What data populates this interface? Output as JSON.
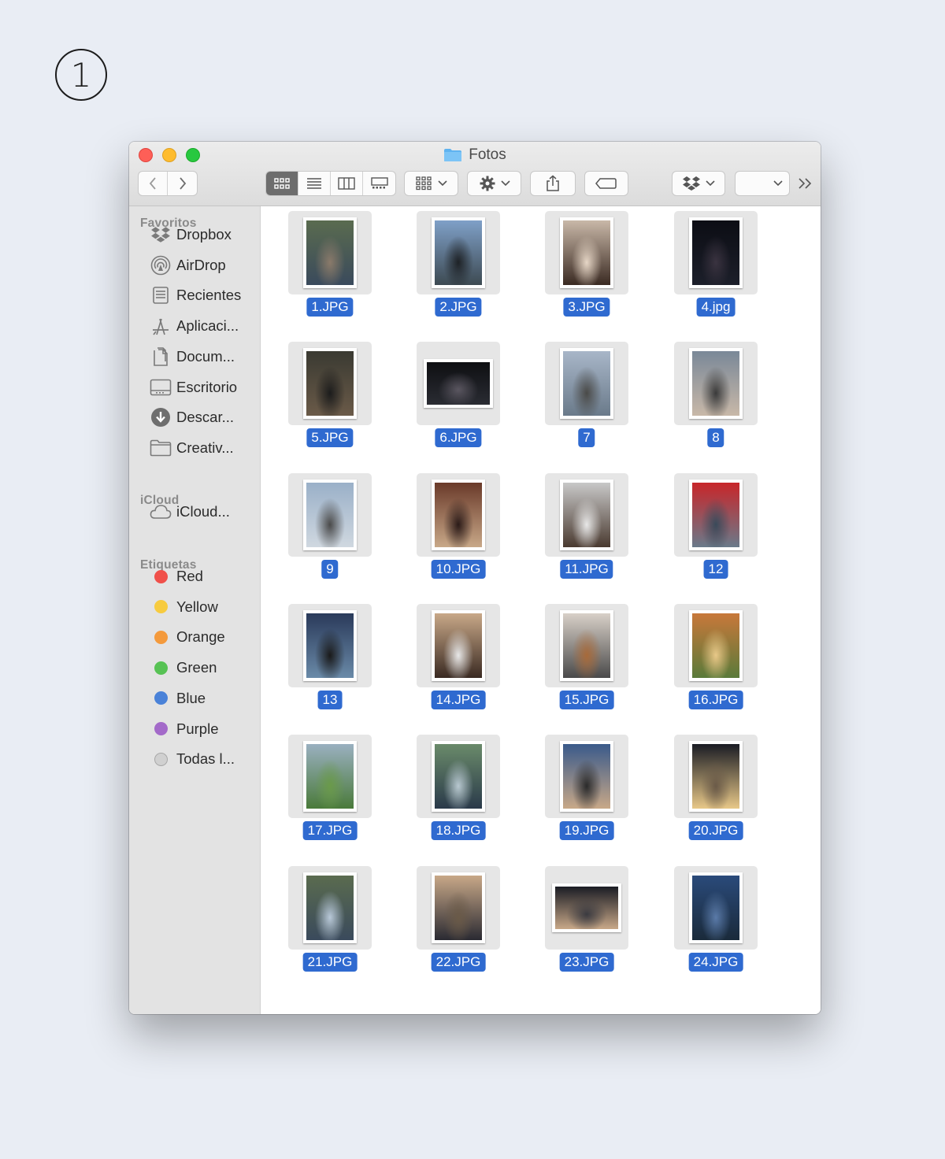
{
  "step": {
    "number": "1"
  },
  "window": {
    "title": "Fotos"
  },
  "sidebar": {
    "favorites_header": "Favoritos",
    "favorites": [
      {
        "label": "Dropbox",
        "icon": "dropbox-icon"
      },
      {
        "label": "AirDrop",
        "icon": "airdrop-icon"
      },
      {
        "label": "Recientes",
        "icon": "recents-icon"
      },
      {
        "label": "Aplicaci...",
        "icon": "applications-icon"
      },
      {
        "label": "Docum...",
        "icon": "documents-icon"
      },
      {
        "label": "Escritorio",
        "icon": "desktop-icon"
      },
      {
        "label": "Descar...",
        "icon": "downloads-icon"
      },
      {
        "label": "Creativ...",
        "icon": "folder-icon"
      }
    ],
    "icloud_header": "iCloud",
    "icloud": [
      {
        "label": "iCloud...",
        "icon": "icloud-icon"
      }
    ],
    "tags_header": "Etiquetas",
    "tags": [
      {
        "label": "Red",
        "color": "#f0504a"
      },
      {
        "label": "Yellow",
        "color": "#f7cb3f"
      },
      {
        "label": "Orange",
        "color": "#f49a3c"
      },
      {
        "label": "Green",
        "color": "#57c254"
      },
      {
        "label": "Blue",
        "color": "#4a82d8"
      },
      {
        "label": "Purple",
        "color": "#a36ac9"
      },
      {
        "label": "Todas l...",
        "color": "#d0d0d0"
      }
    ]
  },
  "files": [
    {
      "name": "1.JPG",
      "orientation": "portrait",
      "palette": [
        "#5a6b4f",
        "#3a4a5c",
        "#8a7a6a"
      ]
    },
    {
      "name": "2.JPG",
      "orientation": "portrait",
      "palette": [
        "#7fa0c8",
        "#3d4a52",
        "#1e2226"
      ]
    },
    {
      "name": "3.JPG",
      "orientation": "portrait",
      "palette": [
        "#c9b8a8",
        "#3a2a22",
        "#e6d6c6"
      ]
    },
    {
      "name": "4.jpg",
      "orientation": "portrait",
      "palette": [
        "#0c0d14",
        "#1c1f2a",
        "#3a3340"
      ]
    },
    {
      "name": "5.JPG",
      "orientation": "portrait",
      "palette": [
        "#3a3a32",
        "#6a5a48",
        "#1c1c1c"
      ]
    },
    {
      "name": "6.JPG",
      "orientation": "landscape",
      "palette": [
        "#0e0f12",
        "#2a2c33",
        "#5a5660"
      ]
    },
    {
      "name": "7",
      "orientation": "portrait",
      "palette": [
        "#a8b6c8",
        "#6a7a8a",
        "#4a4a48"
      ]
    },
    {
      "name": "8",
      "orientation": "portrait",
      "palette": [
        "#7a8898",
        "#c8b8a8",
        "#3a3a3a"
      ]
    },
    {
      "name": "9",
      "orientation": "portrait",
      "palette": [
        "#9ab0c8",
        "#d0d8e0",
        "#4a4a4a"
      ]
    },
    {
      "name": "10.JPG",
      "orientation": "portrait",
      "palette": [
        "#6a3a2a",
        "#c8a888",
        "#2a1a18"
      ]
    },
    {
      "name": "11.JPG",
      "orientation": "portrait",
      "palette": [
        "#c8c8c8",
        "#4a3a30",
        "#e8e8e8"
      ]
    },
    {
      "name": "12",
      "orientation": "portrait",
      "palette": [
        "#c8262a",
        "#6a7a8a",
        "#3a4a5a"
      ]
    },
    {
      "name": "13",
      "orientation": "portrait",
      "palette": [
        "#2a3a5a",
        "#6a8aa8",
        "#1a1a1a"
      ]
    },
    {
      "name": "14.JPG",
      "orientation": "portrait",
      "palette": [
        "#c8a888",
        "#3a2a22",
        "#e8e8e8"
      ]
    },
    {
      "name": "15.JPG",
      "orientation": "portrait",
      "palette": [
        "#d8d0c8",
        "#4a4a4a",
        "#a86a3a"
      ]
    },
    {
      "name": "16.JPG",
      "orientation": "portrait",
      "palette": [
        "#c8783a",
        "#5a7a3a",
        "#e8c888"
      ]
    },
    {
      "name": "17.JPG",
      "orientation": "portrait",
      "palette": [
        "#9ab0c0",
        "#4a7a3a",
        "#6a9a4a"
      ]
    },
    {
      "name": "18.JPG",
      "orientation": "portrait",
      "palette": [
        "#6a8a6a",
        "#2a3a4a",
        "#b8c8d0"
      ]
    },
    {
      "name": "19.JPG",
      "orientation": "portrait",
      "palette": [
        "#3a5a8a",
        "#c8a888",
        "#2a2a2a"
      ]
    },
    {
      "name": "20.JPG",
      "orientation": "portrait",
      "palette": [
        "#1a1c24",
        "#e8c888",
        "#6a5a48"
      ]
    },
    {
      "name": "21.JPG",
      "orientation": "portrait",
      "palette": [
        "#5a6b4f",
        "#3a4a5c",
        "#b8c8d8"
      ]
    },
    {
      "name": "22.JPG",
      "orientation": "portrait",
      "palette": [
        "#c8a888",
        "#2a2a32",
        "#6a5a48"
      ]
    },
    {
      "name": "23.JPG",
      "orientation": "landscape",
      "palette": [
        "#1a1c24",
        "#c8a888",
        "#3a3a40"
      ]
    },
    {
      "name": "24.JPG",
      "orientation": "portrait",
      "palette": [
        "#2a4a7a",
        "#1a2a3a",
        "#5a7aa8"
      ]
    }
  ]
}
